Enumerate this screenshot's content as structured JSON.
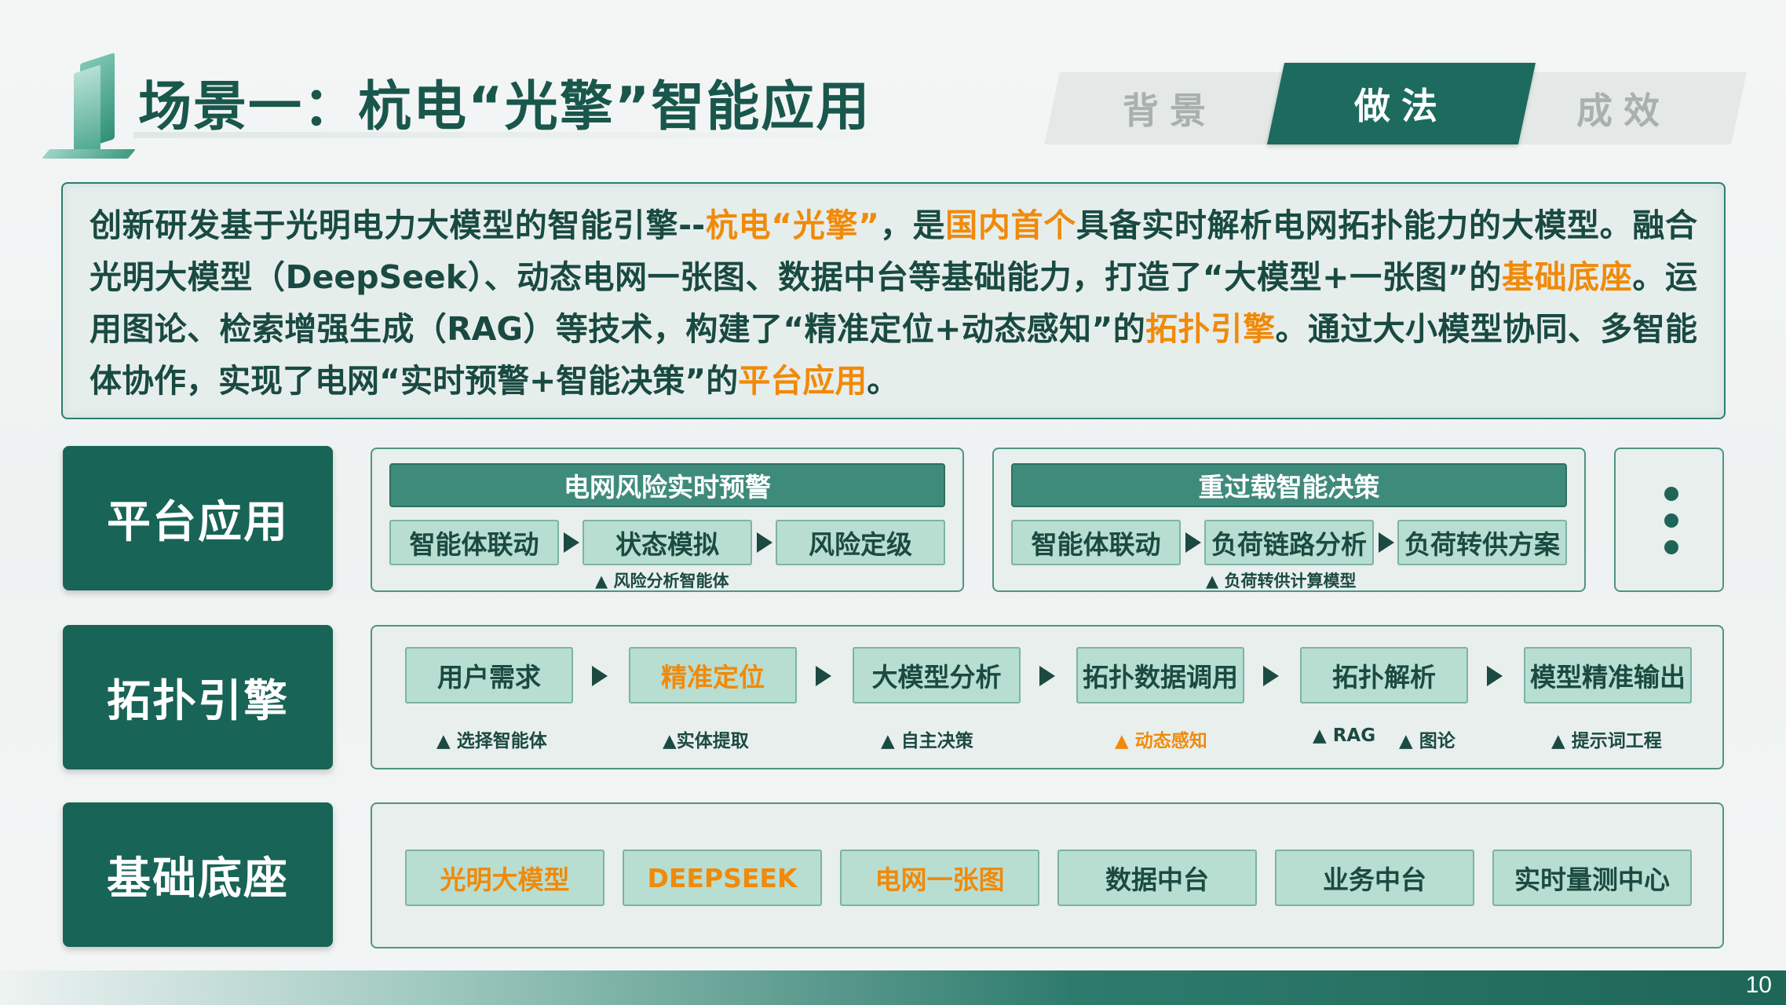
{
  "header": {
    "title": "场景一：杭电“光擎”智能应用",
    "tabs": [
      {
        "label": "背景",
        "active": false
      },
      {
        "label": "做法",
        "active": true
      },
      {
        "label": "成效",
        "active": false
      }
    ]
  },
  "intro": {
    "segments": [
      {
        "text": "创新研发基于光明电力大模型的智能引擎--",
        "highlight": false
      },
      {
        "text": "杭电“光擎”",
        "highlight": true
      },
      {
        "text": "，是",
        "highlight": false
      },
      {
        "text": "国内首个",
        "highlight": true
      },
      {
        "text": "具备实时解析电网拓扑能力的大模型。融合光明大模型（DeepSeek）、动态电网一张图、数据中台等基础能力，打造了“大模型+一张图”的",
        "highlight": false
      },
      {
        "text": "基础底座",
        "highlight": true
      },
      {
        "text": "。运用图论、检索增强生成（RAG）等技术，构建了“精准定位+动态感知”的",
        "highlight": false
      },
      {
        "text": "拓扑引擎",
        "highlight": true
      },
      {
        "text": "。通过大小模型协同、多智能体协作，实现了电网“实时预警+智能决策”的",
        "highlight": false
      },
      {
        "text": "平台应用",
        "highlight": true
      },
      {
        "text": "。",
        "highlight": false
      }
    ]
  },
  "rows": {
    "platform": {
      "label": "平台应用",
      "cards": [
        {
          "title": "电网风险实时预警",
          "steps": [
            "智能体联动",
            "状态模拟",
            "风险定级"
          ],
          "note": "▲ 风险分析智能体"
        },
        {
          "title": "重过载智能决策",
          "steps": [
            "智能体联动",
            "负荷链路分析",
            "负荷转供方案"
          ],
          "note": "▲ 负荷转供计算模型"
        }
      ]
    },
    "engine": {
      "label": "拓扑引擎",
      "steps": [
        {
          "label": "用户需求",
          "orange": false
        },
        {
          "label": "精准定位",
          "orange": true
        },
        {
          "label": "大模型分析",
          "orange": false
        },
        {
          "label": "拓扑数据调用",
          "orange": false
        },
        {
          "label": "拓扑解析",
          "orange": false
        },
        {
          "label": "模型精准输出",
          "orange": false
        }
      ],
      "notes": [
        {
          "text": "▲ 选择智能体",
          "orange": false
        },
        {
          "text": "▲实体提取",
          "orange": false
        },
        {
          "text": "▲ 自主决策",
          "orange": false
        },
        {
          "text": "▲ 动态感知",
          "orange": true
        },
        {
          "text": "▲ RAG",
          "orange": false
        },
        {
          "text": "▲ 图论",
          "orange": false
        },
        {
          "text": "▲ 提示词工程",
          "orange": false
        }
      ]
    },
    "base": {
      "label": "基础底座",
      "items": [
        {
          "label": "光明大模型",
          "orange": true
        },
        {
          "label": "DEEPSEEK",
          "orange": true
        },
        {
          "label": "电网一张图",
          "orange": true
        },
        {
          "label": "数据中台",
          "orange": false
        },
        {
          "label": "业务中台",
          "orange": false
        },
        {
          "label": "实时量测中心",
          "orange": false
        }
      ]
    }
  },
  "footer": {
    "page_number": "10"
  },
  "colors": {
    "primary": "#186456",
    "accent": "#f08a0a",
    "box": "#b8ded2"
  }
}
